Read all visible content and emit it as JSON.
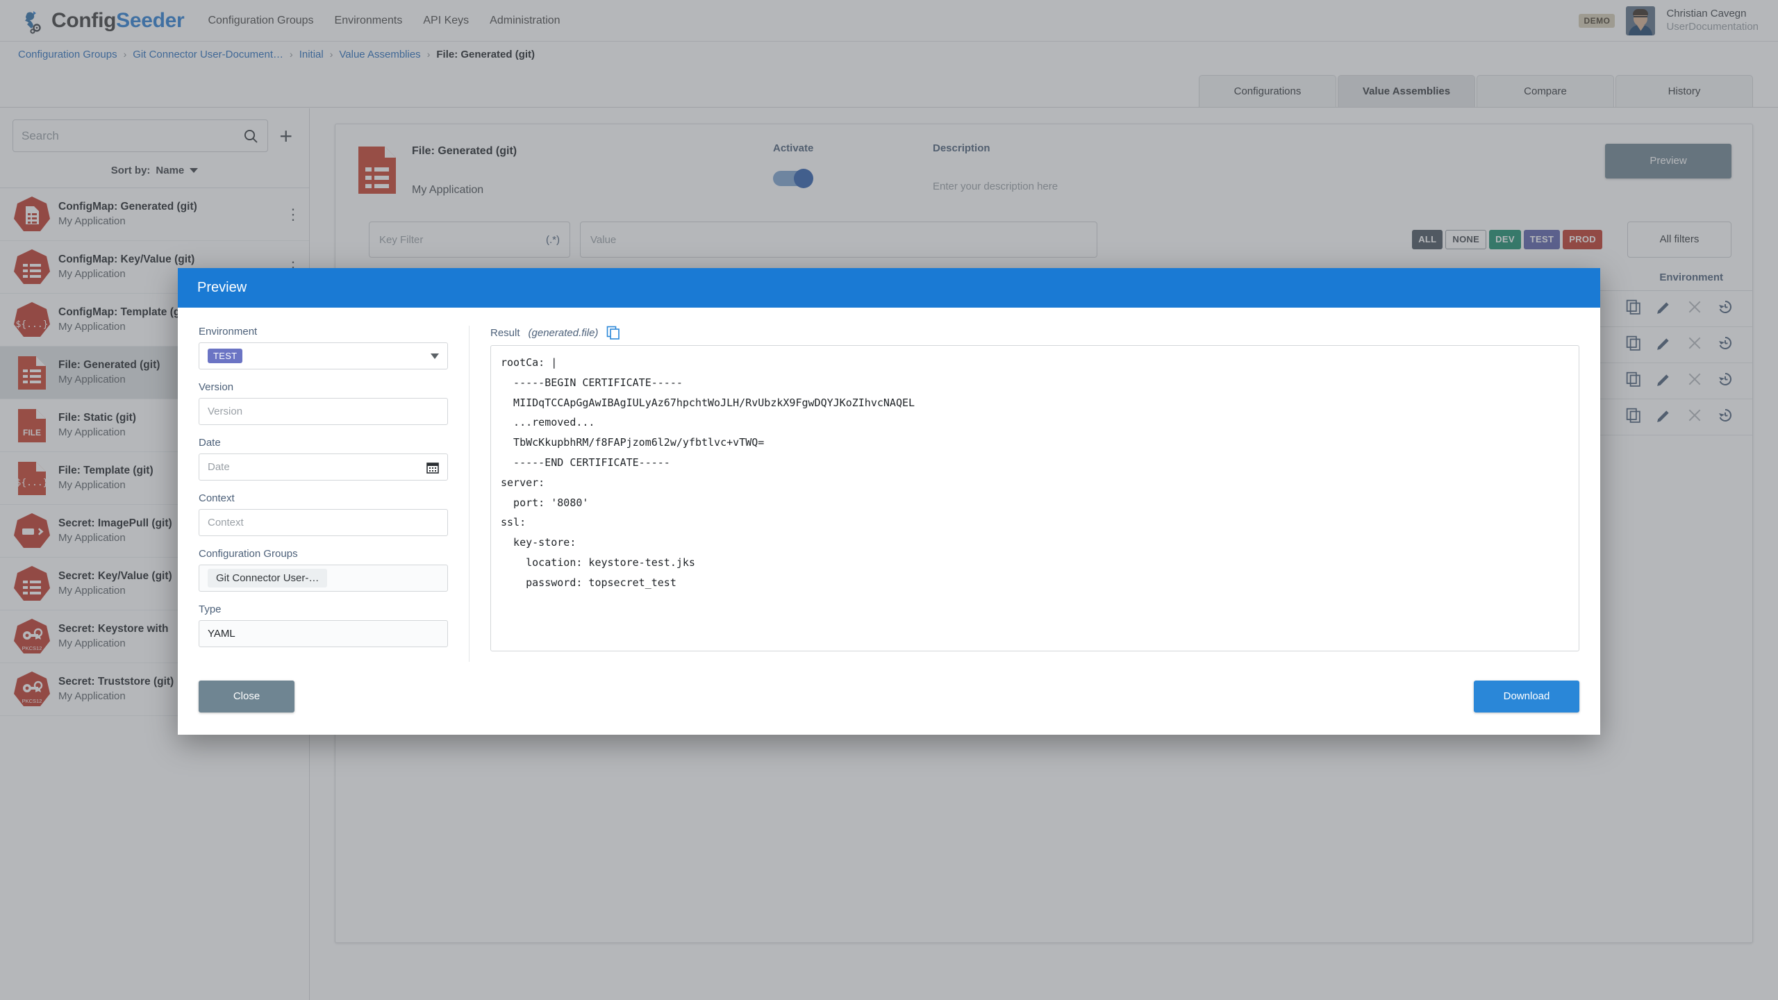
{
  "app": {
    "brand_part1": "Config",
    "brand_part2": "Seeder",
    "demo_badge": "DEMO"
  },
  "nav": {
    "items": [
      {
        "label": "Configuration Groups"
      },
      {
        "label": "Environments"
      },
      {
        "label": "API Keys"
      },
      {
        "label": "Administration"
      }
    ]
  },
  "user": {
    "name": "Christian Cavegn",
    "role": "UserDocumentation"
  },
  "breadcrumb": {
    "items": [
      {
        "label": "Configuration Groups",
        "current": false
      },
      {
        "label": "Git Connector User-Document…",
        "current": false
      },
      {
        "label": "Initial",
        "current": false
      },
      {
        "label": "Value Assemblies",
        "current": false
      },
      {
        "label": "File: Generated (git)",
        "current": true
      }
    ],
    "separator": "›"
  },
  "tabs": [
    {
      "label": "Configurations",
      "active": false
    },
    {
      "label": "Value Assemblies",
      "active": true
    },
    {
      "label": "Compare",
      "active": false
    },
    {
      "label": "History",
      "active": false
    }
  ],
  "sidebar": {
    "search_placeholder": "Search",
    "add_label": "+",
    "sort_label": "Sort by:",
    "sort_value": "Name",
    "items": [
      {
        "title": "ConfigMap: Generated (git)",
        "subtitle": "My Application",
        "icon": "configmap-generated-icon",
        "shape": "hept",
        "glyph": "doc-lines",
        "selected": false,
        "kebab": true
      },
      {
        "title": "ConfigMap: Key/Value (git)",
        "subtitle": "My Application",
        "icon": "configmap-keyvalue-icon",
        "shape": "hept",
        "glyph": "lines",
        "selected": false,
        "kebab": true
      },
      {
        "title": "ConfigMap: Template (git)",
        "subtitle": "My Application",
        "icon": "configmap-template-icon",
        "shape": "hept",
        "glyph": "tpl",
        "selected": false,
        "kebab": true
      },
      {
        "title": "File: Generated (git)",
        "subtitle": "My Application",
        "icon": "file-generated-icon",
        "shape": "file",
        "glyph": "lines",
        "selected": true,
        "kebab": true
      },
      {
        "title": "File: Static (git)",
        "subtitle": "My Application",
        "icon": "file-static-icon",
        "shape": "file",
        "glyph": "FILE",
        "selected": false,
        "kebab": true
      },
      {
        "title": "File: Template (git)",
        "subtitle": "My Application",
        "icon": "file-template-icon",
        "shape": "file",
        "glyph": "tpl",
        "selected": false,
        "kebab": true
      },
      {
        "title": "Secret: ImagePull (git)",
        "subtitle": "My Application",
        "icon": "secret-imagepull-icon",
        "shape": "hept",
        "glyph": "push",
        "selected": false,
        "kebab": true
      },
      {
        "title": "Secret: Key/Value (git)",
        "subtitle": "My Application",
        "icon": "secret-keyvalue-icon",
        "shape": "hept",
        "glyph": "lines",
        "selected": false,
        "kebab": true
      },
      {
        "title": "Secret: Keystore with",
        "subtitle": "My Application",
        "icon": "secret-keystore-icon",
        "shape": "hept",
        "glyph": "PKCS12",
        "selected": false,
        "kebab": true
      },
      {
        "title": "Secret: Truststore (git)",
        "subtitle": "My Application",
        "icon": "secret-truststore-icon",
        "shape": "hept",
        "glyph": "PKCS12",
        "selected": false,
        "kebab": true
      }
    ]
  },
  "detail": {
    "title": "File: Generated (git)",
    "subtitle": "My Application",
    "activate_label": "Activate",
    "activate_on": true,
    "description_label": "Description",
    "description_placeholder": "Enter your description here",
    "preview_button": "Preview",
    "key_filter_placeholder": "Key Filter",
    "key_filter_regex": "(.*)",
    "value_placeholder": "Value",
    "all_filters_label": "All filters",
    "env_chips": [
      {
        "label": "ALL",
        "color": "#4a5560"
      },
      {
        "label": "NONE",
        "color": "#ffffff"
      },
      {
        "label": "DEV",
        "color": "#1a8f6e"
      },
      {
        "label": "TEST",
        "color": "#5c61ab"
      },
      {
        "label": "PROD",
        "color": "#c0392b"
      }
    ],
    "column_environment": "Environment",
    "row_actions": [
      "copy-icon",
      "edit-icon",
      "delete-icon",
      "history-icon"
    ],
    "row_count": 4
  },
  "dialog": {
    "title": "Preview",
    "environment_label": "Environment",
    "environment_value": "TEST",
    "version_label": "Version",
    "version_placeholder": "Version",
    "date_label": "Date",
    "date_placeholder": "Date",
    "context_label": "Context",
    "context_placeholder": "Context",
    "configuration_groups_label": "Configuration Groups",
    "configuration_groups_value": "Git Connector User-…",
    "type_label": "Type",
    "type_value": "YAML",
    "result_label": "Result",
    "result_filename": "(generated.file)",
    "result_text": "rootCa: |\n  -----BEGIN CERTIFICATE-----\n  MIIDqTCCApGgAwIBAgIULyAz67hpchtWoJLH/RvUbzkX9FgwDQYJKoZIhvcNAQEL\n  ...removed...\n  TbWcKkupbhRM/f8FAPjzom6l2w/yfbtlvc+vTWQ=\n  -----END CERTIFICATE-----\nserver:\n  port: '8080'\nssl:\n  key-store:\n    location: keystore-test.jks\n    password: topsecret_test",
    "close_label": "Close",
    "download_label": "Download"
  },
  "colors": {
    "brand_blue": "#2a7fd4",
    "dialog_header": "#1a7ad4",
    "download_btn": "#2a87d8",
    "close_btn": "#6f8592",
    "icon_red": "#c0392b",
    "env_test": "#6b74c4"
  }
}
